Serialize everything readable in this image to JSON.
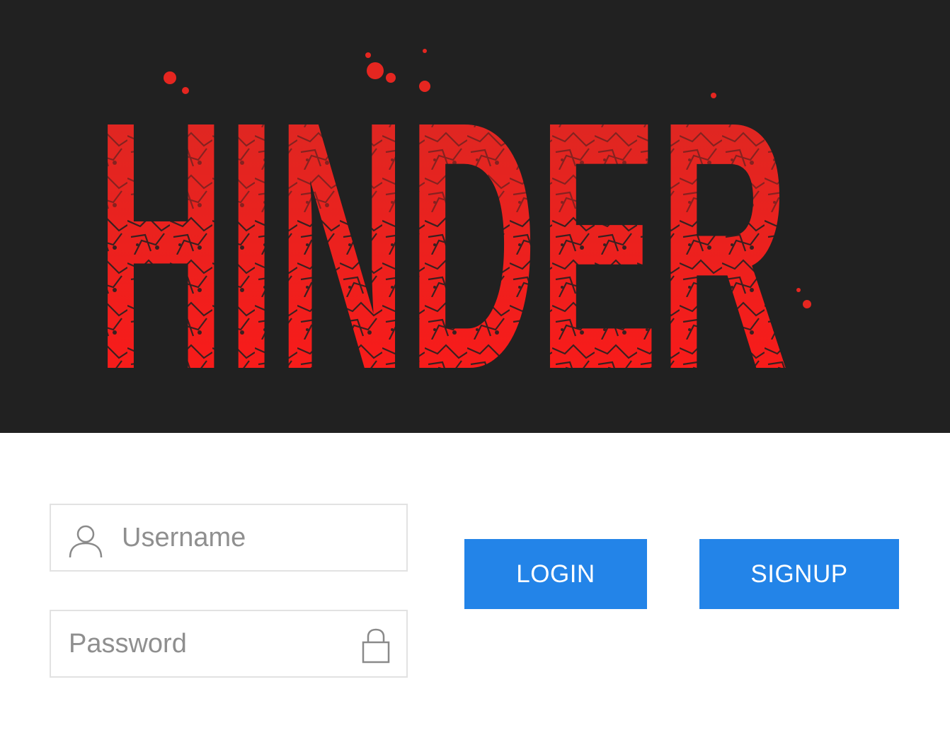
{
  "banner": {
    "logo_text": "HINDER",
    "logo_colors": {
      "top": "#d82a24",
      "bottom": "#ff1818",
      "background": "#212121"
    }
  },
  "login_form": {
    "username": {
      "placeholder": "Username",
      "value": "",
      "icon": "user-icon"
    },
    "password": {
      "placeholder": "Password",
      "value": "",
      "icon": "lock-icon"
    }
  },
  "buttons": {
    "login_label": "LOGIN",
    "signup_label": "SIGNUP",
    "color": "#2384e8"
  }
}
